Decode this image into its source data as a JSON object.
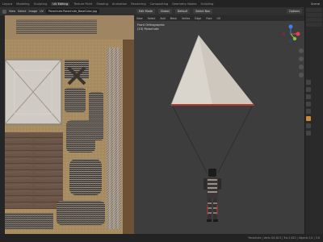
{
  "topbar": {
    "tabs": [
      "Layout",
      "Modeling",
      "Sculpting",
      "UV Editing",
      "Texture Paint",
      "Shading",
      "Animation",
      "Rendering",
      "Compositing",
      "Geometry Nodes",
      "Scripting"
    ],
    "active_tab": "UV Editing",
    "scene_label": "Scene"
  },
  "uv_editor": {
    "mode": "UV Editor",
    "menus": [
      "View",
      "Select",
      "Image",
      "UV"
    ],
    "image_name": "Parachute.Parachute_BaseColor.jpg"
  },
  "viewport": {
    "mode": "Edit Mode",
    "menus": [
      "View",
      "Select",
      "Add",
      "Mesh",
      "Vertex",
      "Edge",
      "Face",
      "UV"
    ],
    "orientation": "Global",
    "pivot": "Default",
    "drag": "Select Box",
    "options_label": "Options",
    "view_name": "Front Orthographic",
    "object_name": "(23) Parachute",
    "gizmo_axes": [
      "X",
      "Y",
      "Z"
    ]
  },
  "statusbar": {
    "left_text": "",
    "right_text": "Parachute | Verts 0/2,613 | Tris 2,622 | Objects 1/1 | 3.6"
  },
  "colors": {
    "axis_x": "#e8404f",
    "axis_y": "#8ac23a",
    "axis_z": "#3f7fe8",
    "canopy": "#d9d4cc",
    "canopy_trim": "#b23a2e"
  }
}
